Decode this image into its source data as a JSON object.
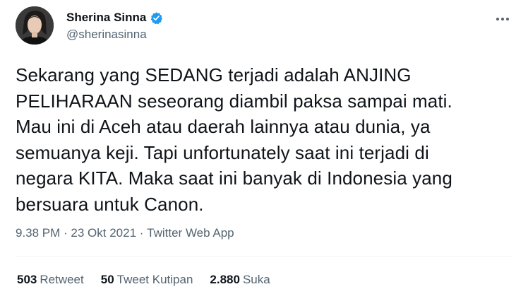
{
  "user": {
    "display_name": "Sherina Sinna",
    "handle": "@sherinasinna",
    "verified_icon": "verified-badge-icon",
    "accent_color": "#1d9bf0"
  },
  "tweet": {
    "text": "Sekarang yang SEDANG terjadi adalah ANJING\nPELIHARAAN seseorang diambil paksa sampai mati.\nMau ini di Aceh atau daerah lainnya atau dunia, ya\nsemuanya keji. Tapi unfortunately saat ini terjadi di\nnegara KITA. Maka saat ini banyak di Indonesia yang\nbersuara untuk Canon.",
    "time": "9.38 PM",
    "separator": " · ",
    "date": "23 Okt 2021",
    "source": "Twitter Web App"
  },
  "stats": {
    "retweets": {
      "count": "503",
      "label": "Retweet"
    },
    "quotes": {
      "count": "50",
      "label": "Tweet Kutipan"
    },
    "likes": {
      "count": "2.880",
      "label": "Suka"
    }
  },
  "icons": {
    "more": "more-options-icon"
  }
}
